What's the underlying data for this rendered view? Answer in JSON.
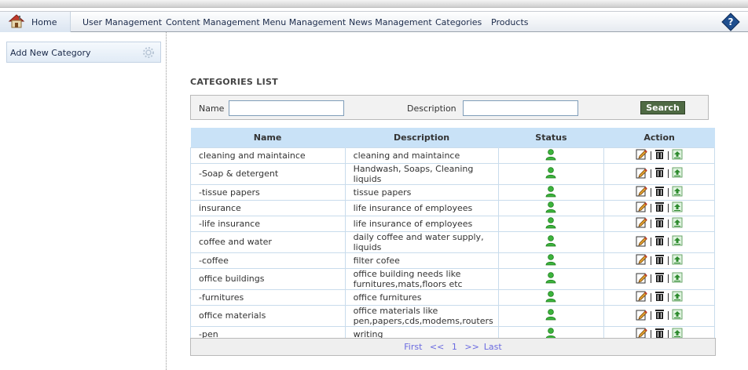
{
  "nav": {
    "home": "Home",
    "items": [
      "User Management",
      "Content Management",
      "Menu Management",
      "News Management",
      "Categories",
      "Products"
    ]
  },
  "sidebar": {
    "add_category": "Add New Category"
  },
  "page": {
    "title": "CATEGORIES LIST"
  },
  "search": {
    "name_label": "Name",
    "name_value": "",
    "description_label": "Description",
    "description_value": "",
    "button": "Search"
  },
  "table": {
    "headers": [
      "Name",
      "Description",
      "Status",
      "Action"
    ],
    "rows": [
      {
        "name": "cleaning and maintaince",
        "description": "cleaning and maintaince"
      },
      {
        "name": " -Soap & detergent",
        "description": "Handwash, Soaps, Cleaning liquids"
      },
      {
        "name": " -tissue papers",
        "description": "tissue papers"
      },
      {
        "name": "insurance",
        "description": "life insurance of employees"
      },
      {
        "name": " -life insurance",
        "description": "life insurance of employees"
      },
      {
        "name": "coffee and water",
        "description": "daily coffee and water supply, liquids"
      },
      {
        "name": " -coffee",
        "description": "filter cofee"
      },
      {
        "name": "office buildings",
        "description": "office building needs like furnitures,mats,floors etc"
      },
      {
        "name": " -furnitures",
        "description": "office furnitures"
      },
      {
        "name": "office materials",
        "description": "office materials like pen,papers,cds,modems,routers"
      },
      {
        "name": " -pen",
        "description": "writing"
      }
    ]
  },
  "pager": {
    "first": "First",
    "prev": "<<",
    "current": "1",
    "next": ">>",
    "last": "Last"
  },
  "colors": {
    "header_bg": "#c9e2f7",
    "search_button": "#4f6a44",
    "status_green": "#3cb43c",
    "pager_link": "#6a6ae0"
  },
  "icons": {
    "status": "user-active-icon",
    "edit": "edit-icon",
    "delete": "trash-icon",
    "publish": "upload-icon"
  }
}
